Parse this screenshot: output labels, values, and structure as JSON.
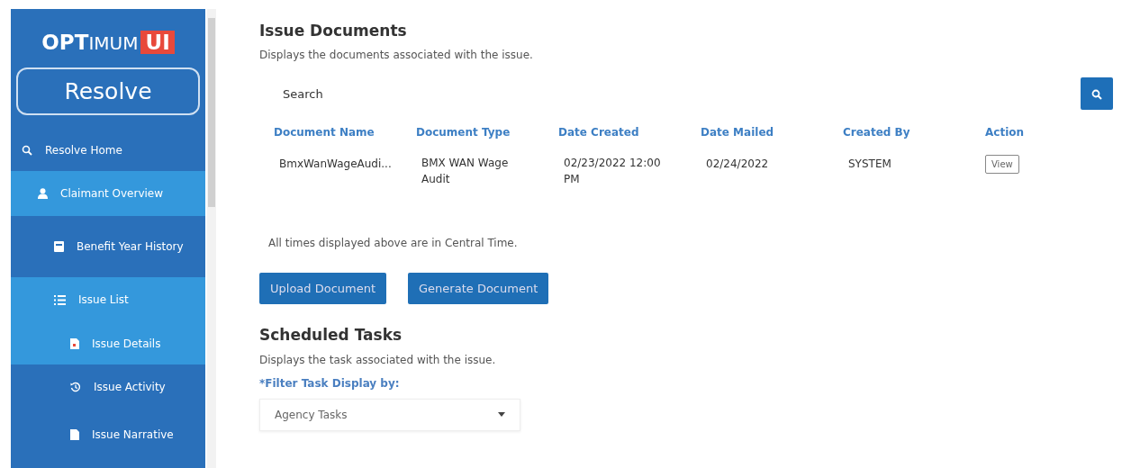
{
  "sidebar": {
    "logo": {
      "part_1": "OPT",
      "part_2": "IMUM",
      "part_3": "UI"
    },
    "app_button": "Resolve",
    "items": [
      {
        "label": "Resolve Home",
        "active": false,
        "children": [
          {
            "label": "Claimant Overview",
            "active": true,
            "children": [
              {
                "label": "Benefit Year History",
                "active": false
              },
              {
                "label": "Issue List",
                "active": true,
                "children": [
                  {
                    "label": "Issue Details",
                    "active": true
                  },
                  {
                    "label": "Issue Activity",
                    "active": false
                  },
                  {
                    "label": "Issue Narrative",
                    "active": false
                  }
                ]
              }
            ]
          }
        ]
      }
    ]
  },
  "documents": {
    "title": "Issue Documents",
    "description": "Displays the documents associated with the issue.",
    "search": {
      "placeholder": "Search"
    },
    "table": {
      "columns": [
        "Document Name",
        "Document Type",
        "Date Created",
        "Date Mailed",
        "Created By",
        "Action"
      ],
      "rows": [
        {
          "cells": [
            "BmxWanWageAudi...",
            "BMX WAN Wage Audit",
            "02/23/2022 12:00 PM",
            "02/24/2022",
            "SYSTEM"
          ],
          "action": "View"
        }
      ]
    },
    "note": "All times displayed above are in Central Time.",
    "buttons": [
      "Upload Document",
      "Generate Document"
    ]
  },
  "tasks": {
    "title": "Scheduled Tasks",
    "description": "Displays the task associated with the issue.",
    "filter_label": "*Filter Task Display by:",
    "filter_value": "Agency Tasks"
  }
}
